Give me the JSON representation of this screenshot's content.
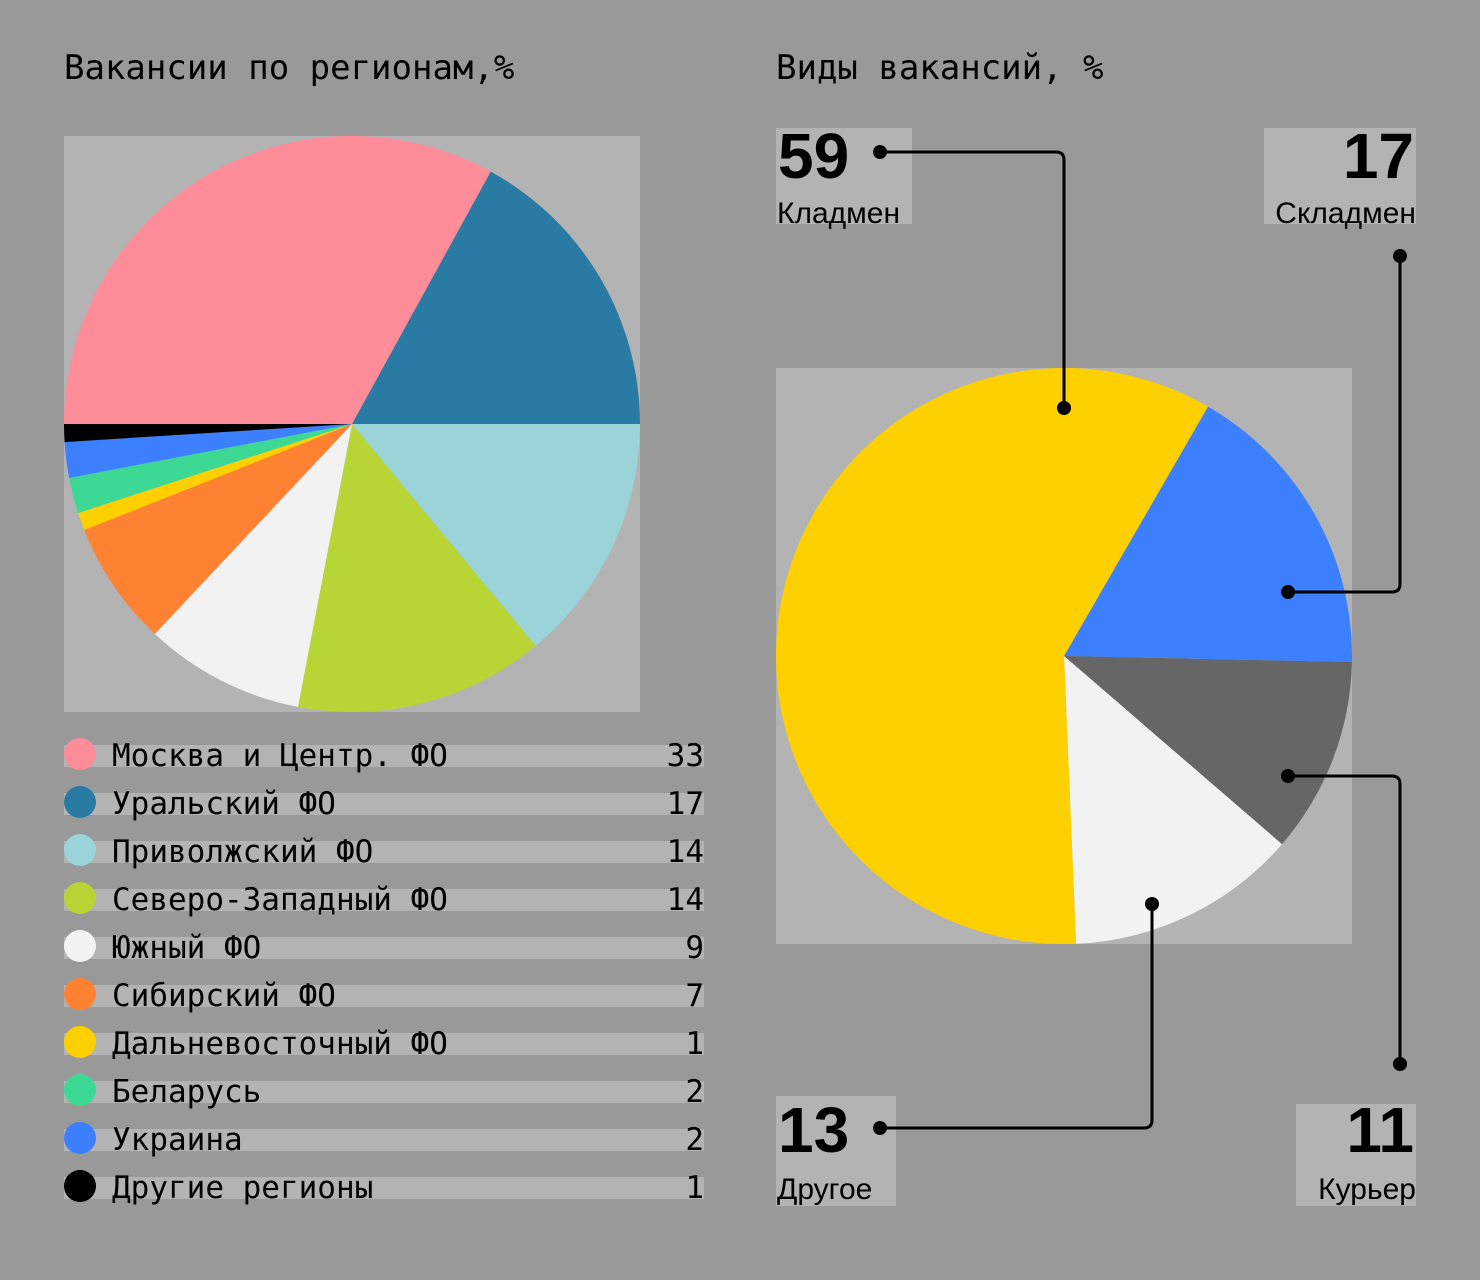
{
  "chart_data": [
    {
      "type": "pie",
      "title": "Вакансии по регионам,%",
      "slices": [
        {
          "label": "Москва и Центр. ФО",
          "value": 33,
          "color": "#ff8c99"
        },
        {
          "label": "Уральский ФО",
          "value": 17,
          "color": "#2a7ba3"
        },
        {
          "label": "Приволжский ФО",
          "value": 14,
          "color": "#9ad4d9"
        },
        {
          "label": "Северо-Западный ФО",
          "value": 14,
          "color": "#b8d435"
        },
        {
          "label": "Южный ФО",
          "value": 9,
          "color": "#f2f2f2"
        },
        {
          "label": "Сибирский ФО",
          "value": 7,
          "color": "#ff8233"
        },
        {
          "label": "Дальневосточный ФО",
          "value": 1,
          "color": "#ffd000"
        },
        {
          "label": "Беларусь",
          "value": 2,
          "color": "#3dd994"
        },
        {
          "label": "Украина",
          "value": 2,
          "color": "#3d80ff"
        },
        {
          "label": "Другие регионы",
          "value": 1,
          "color": "#000000"
        }
      ]
    },
    {
      "type": "pie",
      "title": "Виды вакансий, %",
      "slices": [
        {
          "label": "Складмен",
          "value": 17,
          "color": "#3d80ff"
        },
        {
          "label": "Курьер",
          "value": 11,
          "color": "#666666"
        },
        {
          "label": "Другое",
          "value": 13,
          "color": "#f2f2f2"
        },
        {
          "label": "Кладмен",
          "value": 59,
          "color": "#ffd000"
        }
      ]
    }
  ]
}
